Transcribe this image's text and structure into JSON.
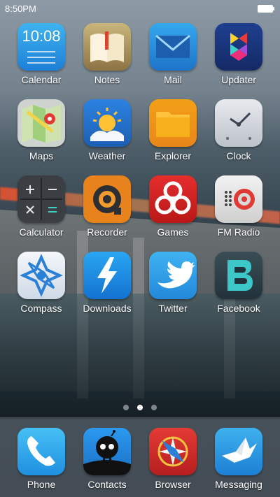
{
  "status_bar": {
    "time": "8:50PM"
  },
  "apps": [
    {
      "label": "Calendar",
      "icon": "calendar-icon",
      "icon_text": "10:08"
    },
    {
      "label": "Notes",
      "icon": "notes-icon"
    },
    {
      "label": "Mail",
      "icon": "mail-icon"
    },
    {
      "label": "Updater",
      "icon": "updater-icon"
    },
    {
      "label": "Maps",
      "icon": "maps-icon"
    },
    {
      "label": "Weather",
      "icon": "weather-icon"
    },
    {
      "label": "Explorer",
      "icon": "folder-icon"
    },
    {
      "label": "Clock",
      "icon": "clock-icon"
    },
    {
      "label": "Calculator",
      "icon": "calculator-icon"
    },
    {
      "label": "Recorder",
      "icon": "recorder-icon"
    },
    {
      "label": "Games",
      "icon": "biohazard-icon"
    },
    {
      "label": "FM Radio",
      "icon": "radio-icon"
    },
    {
      "label": "Compass",
      "icon": "compass-icon"
    },
    {
      "label": "Downloads",
      "icon": "lightning-icon"
    },
    {
      "label": "Twitter",
      "icon": "twitter-bird-icon"
    },
    {
      "label": "Facebook",
      "icon": "facebook-icon"
    }
  ],
  "page_indicator": {
    "pages": 3,
    "active": 2
  },
  "dock": [
    {
      "label": "Phone",
      "icon": "phone-icon"
    },
    {
      "label": "Contacts",
      "icon": "contacts-icon"
    },
    {
      "label": "Browser",
      "icon": "compass-browser-icon"
    },
    {
      "label": "Messaging",
      "icon": "paper-bird-icon"
    }
  ]
}
